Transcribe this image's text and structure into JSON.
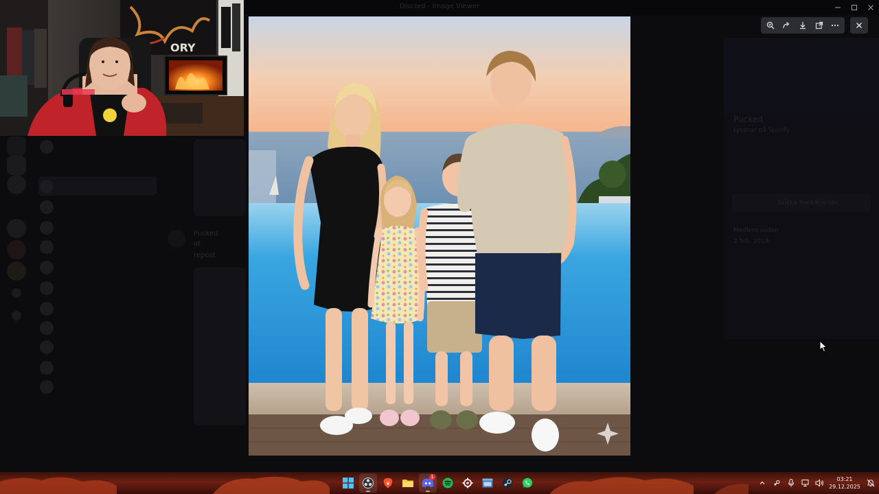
{
  "window": {
    "title": "Discord - Image Viewer",
    "minimize_icon": "minimize-icon",
    "maximize_icon": "maximize-icon",
    "close_icon": "close-icon"
  },
  "viewer": {
    "toolbar": {
      "zoom_icon": "zoom-in-icon",
      "forward_icon": "forward-icon",
      "download_icon": "download-icon",
      "open_external_icon": "open-external-icon",
      "more_icon": "more-icon"
    },
    "close_icon": "close-icon",
    "image_alt": "Photo of four siblings standing in front of an infinity pool at sunset"
  },
  "background_app": {
    "chat_snippets": [
      "Pucked",
      "at",
      "repost"
    ],
    "profile": {
      "name": "Pucked",
      "subtitle": "Lyssnar på Spotify",
      "member_since_label": "Medlem sedan",
      "member_since_value": "2 feb. 2019",
      "button_label": "Skicka meddelande"
    }
  },
  "taskbar": {
    "apps": [
      {
        "name": "start",
        "icon": "windows-start-icon",
        "active": false
      },
      {
        "name": "obs",
        "icon": "obs-icon",
        "active": true
      },
      {
        "name": "brave",
        "icon": "brave-icon",
        "active": false
      },
      {
        "name": "file-explorer",
        "icon": "folder-icon",
        "active": false
      },
      {
        "name": "discord",
        "icon": "discord-icon",
        "active": true,
        "badge": "1"
      },
      {
        "name": "spotify",
        "icon": "spotify-icon",
        "active": false
      },
      {
        "name": "settings",
        "icon": "gear-icon",
        "active": false
      },
      {
        "name": "desktop",
        "icon": "window-icon",
        "active": false
      },
      {
        "name": "steam",
        "icon": "steam-icon",
        "active": false
      },
      {
        "name": "whatsapp",
        "icon": "whatsapp-icon",
        "active": false
      }
    ],
    "tray": {
      "chevron_icon": "chevron-up-icon",
      "steam_tray_icon": "steam-icon",
      "mic_icon": "microphone-icon",
      "network_icon": "network-icon",
      "volume_icon": "volume-icon",
      "notification_icon": "notification-bell-icon"
    },
    "clock": {
      "time": "03:21",
      "date": "29.12.2025"
    }
  },
  "colors": {
    "toolbar_bg": "#2b2d31",
    "discord_blurple": "#5865f2",
    "spotify_green": "#1db954",
    "whatsapp_green": "#25d366",
    "brave_orange": "#fb542b",
    "badge_red": "#e8313b"
  }
}
